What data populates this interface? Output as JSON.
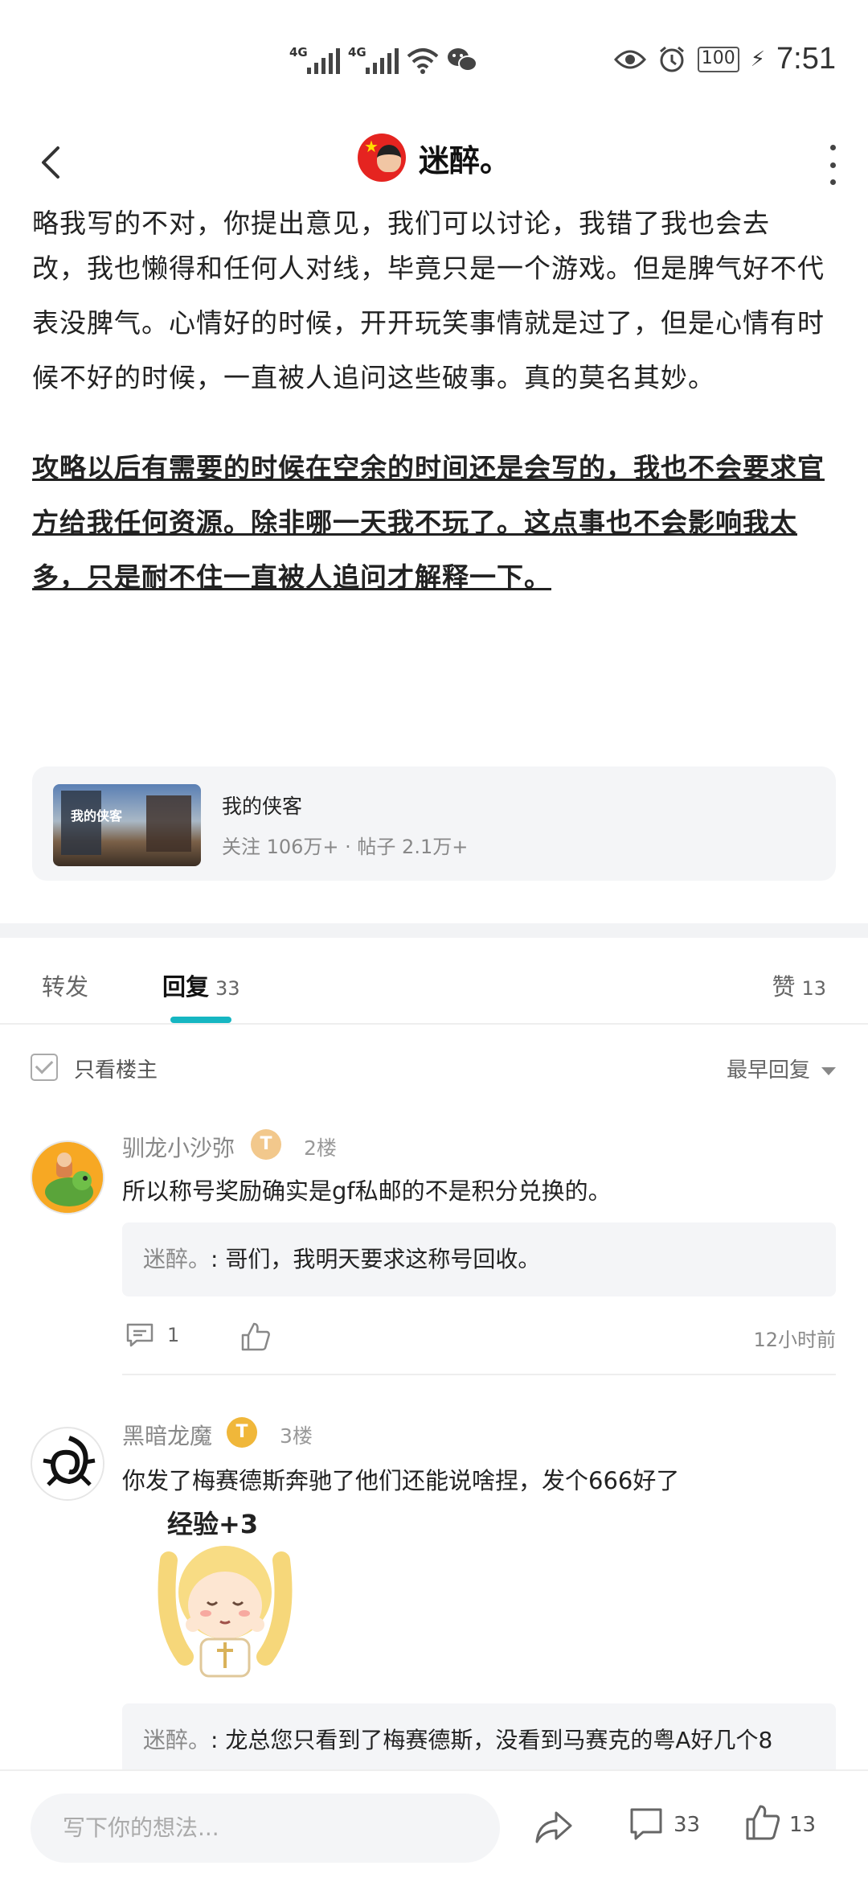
{
  "status_bar": {
    "signal1": "4G",
    "signal2": "4G",
    "battery": "100",
    "time": "7:51"
  },
  "header": {
    "title": "迷醉。"
  },
  "post": {
    "partial_line": "略我写的不对，你提出意见，我们可以讨论，我错了我也会去",
    "paragraph1": "改，我也懒得和任何人对线，毕竟只是一个游戏。但是脾气好不代表没脾气。心情好的时候，开开玩笑事情就是过了，但是心情有时候不好的时候，一直被人追问这些破事。真的莫名其妙。",
    "paragraph2_bold": "攻略以后有需要的时候在空余的时间还是会写的，我也不会要求官方给我任何资源。除非哪一天我不玩了。这点事也不会影响我太多，只是耐不住一直被人追问才解释一下。"
  },
  "forum_card": {
    "name": "我的侠客",
    "stats": "关注 106万+ · 帖子 2.1万+",
    "thumb_title": "我的侠客"
  },
  "tabs": {
    "forward": "转发",
    "reply": "回复",
    "reply_count": "33",
    "like": "赞",
    "like_count": "13"
  },
  "filter": {
    "only_op": "只看楼主",
    "sort": "最早回复"
  },
  "comments": [
    {
      "name": "驯龙小沙弥",
      "badge": "T",
      "floor": "2楼",
      "text": "所以称号奖励确实是gf私邮的不是积分兑换的。",
      "reply_author": "迷醉。",
      "reply_text": "哥们，我明天要求这称号回收。",
      "comment_count": "1",
      "time": "12小时前"
    },
    {
      "name": "黑暗龙魔",
      "badge": "T",
      "floor": "3楼",
      "text": "你发了梅赛德斯奔驰了他们还能说啥捏，发个666好了",
      "sticker_text": "经验+3",
      "reply_author": "迷醉。",
      "reply_text": "龙总您只看到了梅赛德斯，没看到马赛克的粤A好几个8"
    }
  ],
  "bottom_bar": {
    "input_placeholder": "写下你的想法...",
    "comment_count": "33",
    "like_count": "13"
  },
  "colors": {
    "accent": "#16b6c2",
    "badge_light": "#f2c88c",
    "badge_gold": "#f0b73a"
  }
}
